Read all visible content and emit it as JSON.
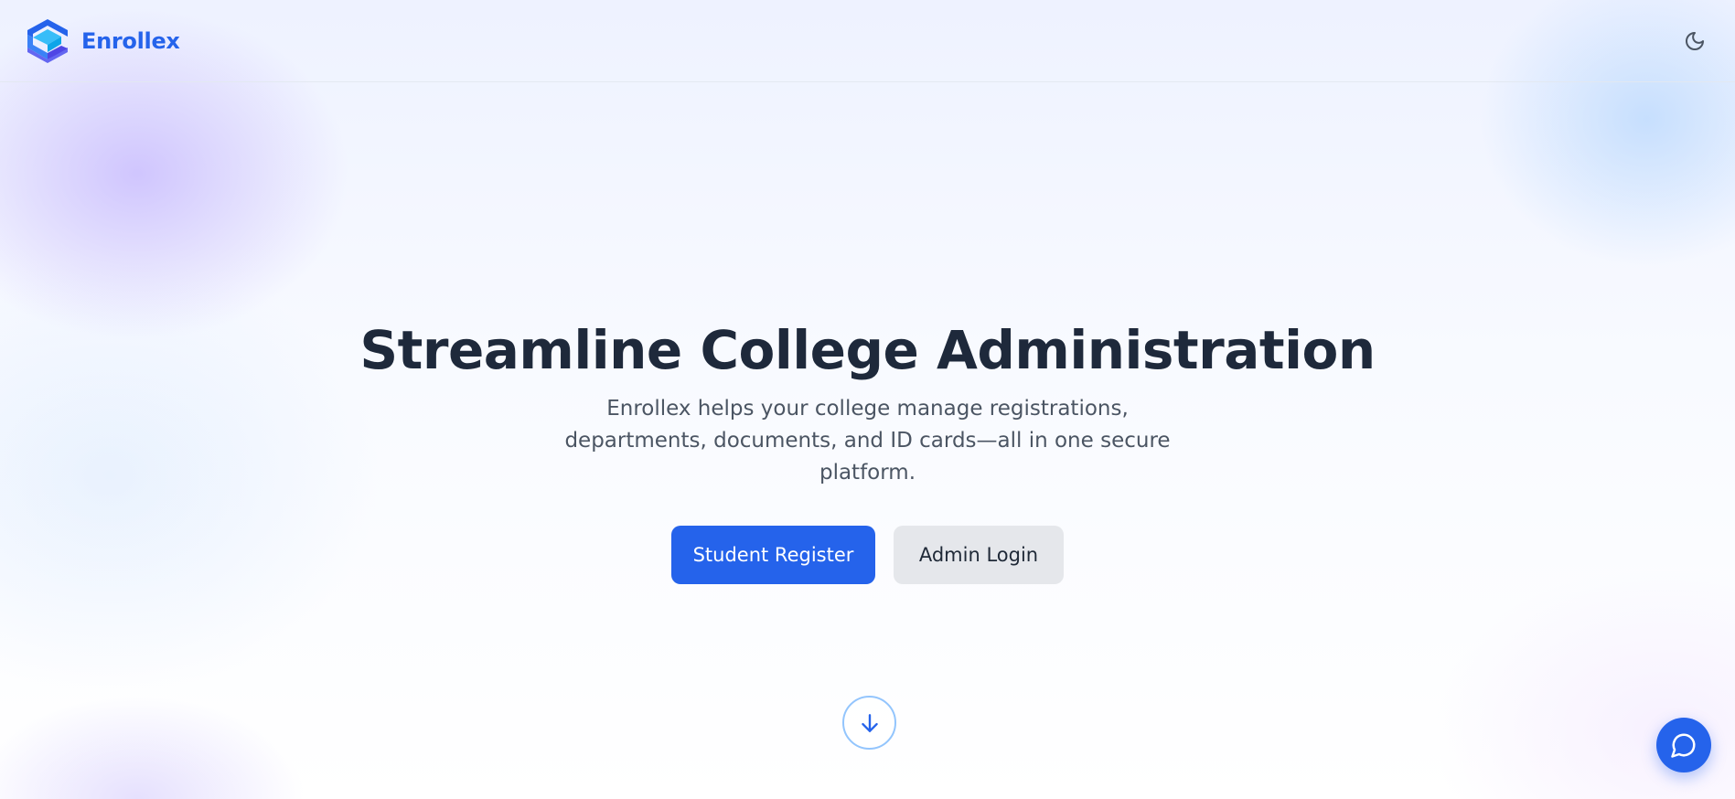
{
  "brand": {
    "name": "Enrollex",
    "logo_icon": "enrollex-logo-icon",
    "color": "#2563eb"
  },
  "header": {
    "theme_toggle_icon": "moon-icon"
  },
  "hero": {
    "title": "Streamline College Administration",
    "subtitle": "Enrollex helps your college manage registrations, departments, documents, and ID cards—all in one secure platform.",
    "primary_button": "Student Register",
    "secondary_button": "Admin Login"
  },
  "scroll_indicator": {
    "icon": "arrow-down-icon"
  },
  "chat_widget": {
    "icon": "chat-bubble-icon"
  },
  "colors": {
    "accent": "#2563eb",
    "title": "#1e293b",
    "subtitle": "#4b5563",
    "secondary_button_bg": "#e5e7eb"
  }
}
